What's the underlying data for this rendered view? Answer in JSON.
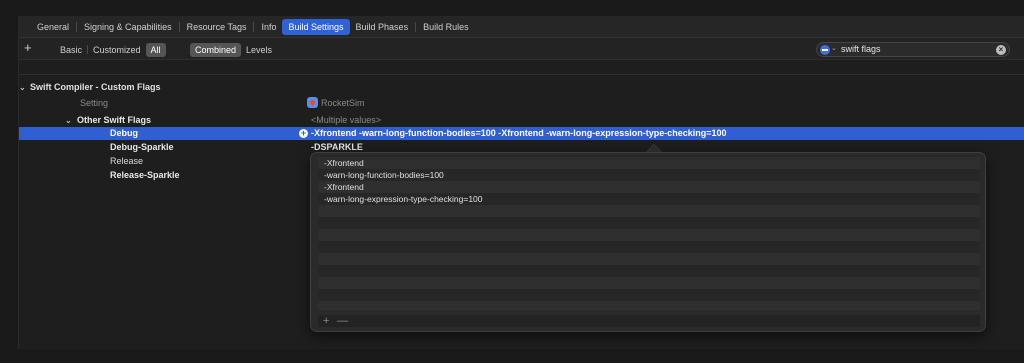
{
  "tabs": [
    "General",
    "Signing & Capabilities",
    "Resource Tags",
    "Info",
    "Build Settings",
    "Build Phases",
    "Build Rules"
  ],
  "active_tab": "Build Settings",
  "filter": {
    "add_label": "+",
    "scope": [
      "Basic",
      "Customized",
      "All"
    ],
    "scope_selected": "All",
    "view": [
      "Combined",
      "Levels"
    ],
    "view_selected": "Combined"
  },
  "search": {
    "value": "swift flags"
  },
  "section": {
    "title": "Swift Compiler - Custom Flags"
  },
  "header_row": {
    "label": "Setting",
    "target": "RocketSim"
  },
  "group": {
    "name": "Other Swift Flags",
    "value": "<Multiple values>"
  },
  "rows": [
    {
      "name": "Debug",
      "value": "-Xfrontend -warn-long-function-bodies=100 -Xfrontend -warn-long-expression-type-checking=100",
      "bold": true,
      "selected": true
    },
    {
      "name": "Debug-Sparkle",
      "value": "-DSPARKLE",
      "bold": true,
      "selected": false
    },
    {
      "name": "Release",
      "value": "",
      "bold": false,
      "selected": false
    },
    {
      "name": "Release-Sparkle",
      "value": "",
      "bold": true,
      "selected": false
    }
  ],
  "popover": {
    "items": [
      "-Xfrontend",
      "-warn-long-function-bodies=100",
      "-Xfrontend",
      "-warn-long-expression-type-checking=100"
    ],
    "add_label": "+",
    "remove_label": "—"
  },
  "colors": {
    "accent": "#2f62d6",
    "selected_row": "#2f5fd2",
    "background": "#1e1e1e"
  }
}
